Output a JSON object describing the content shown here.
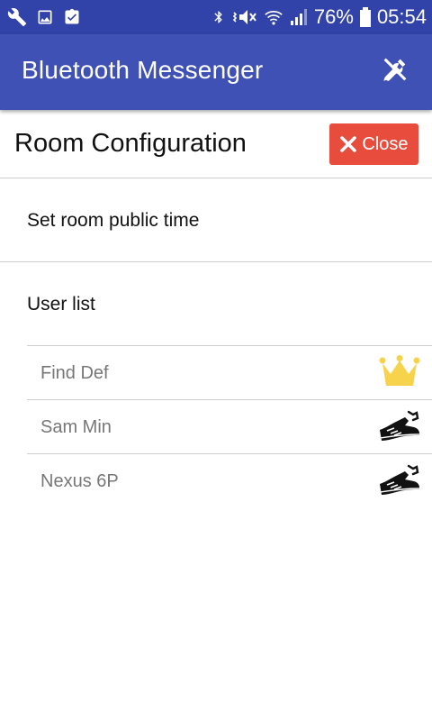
{
  "status_bar": {
    "battery": "76%",
    "time": "05:54",
    "icons_left": [
      "wrench-icon",
      "image-icon",
      "clipboard-check-icon"
    ],
    "icons_right": [
      "bluetooth-icon",
      "vibrate-icon",
      "wifi-icon",
      "signal-icon",
      "battery-icon"
    ]
  },
  "app_bar": {
    "title": "Bluetooth Messenger",
    "action_icon": "tools-icon"
  },
  "header": {
    "title": "Room Configuration",
    "close_label": "Close"
  },
  "menu": {
    "set_time_label": "Set room public time",
    "user_list_label": "User list"
  },
  "users": [
    {
      "name": "Find Def",
      "icon": "crown-icon"
    },
    {
      "name": "Sam Min",
      "icon": "kick-icon"
    },
    {
      "name": "Nexus 6P",
      "icon": "kick-icon"
    }
  ],
  "colors": {
    "status_bar": "#3143a8",
    "app_bar": "#3f51b5",
    "close_button": "#e84c3d",
    "crown": "#f6d34a"
  }
}
